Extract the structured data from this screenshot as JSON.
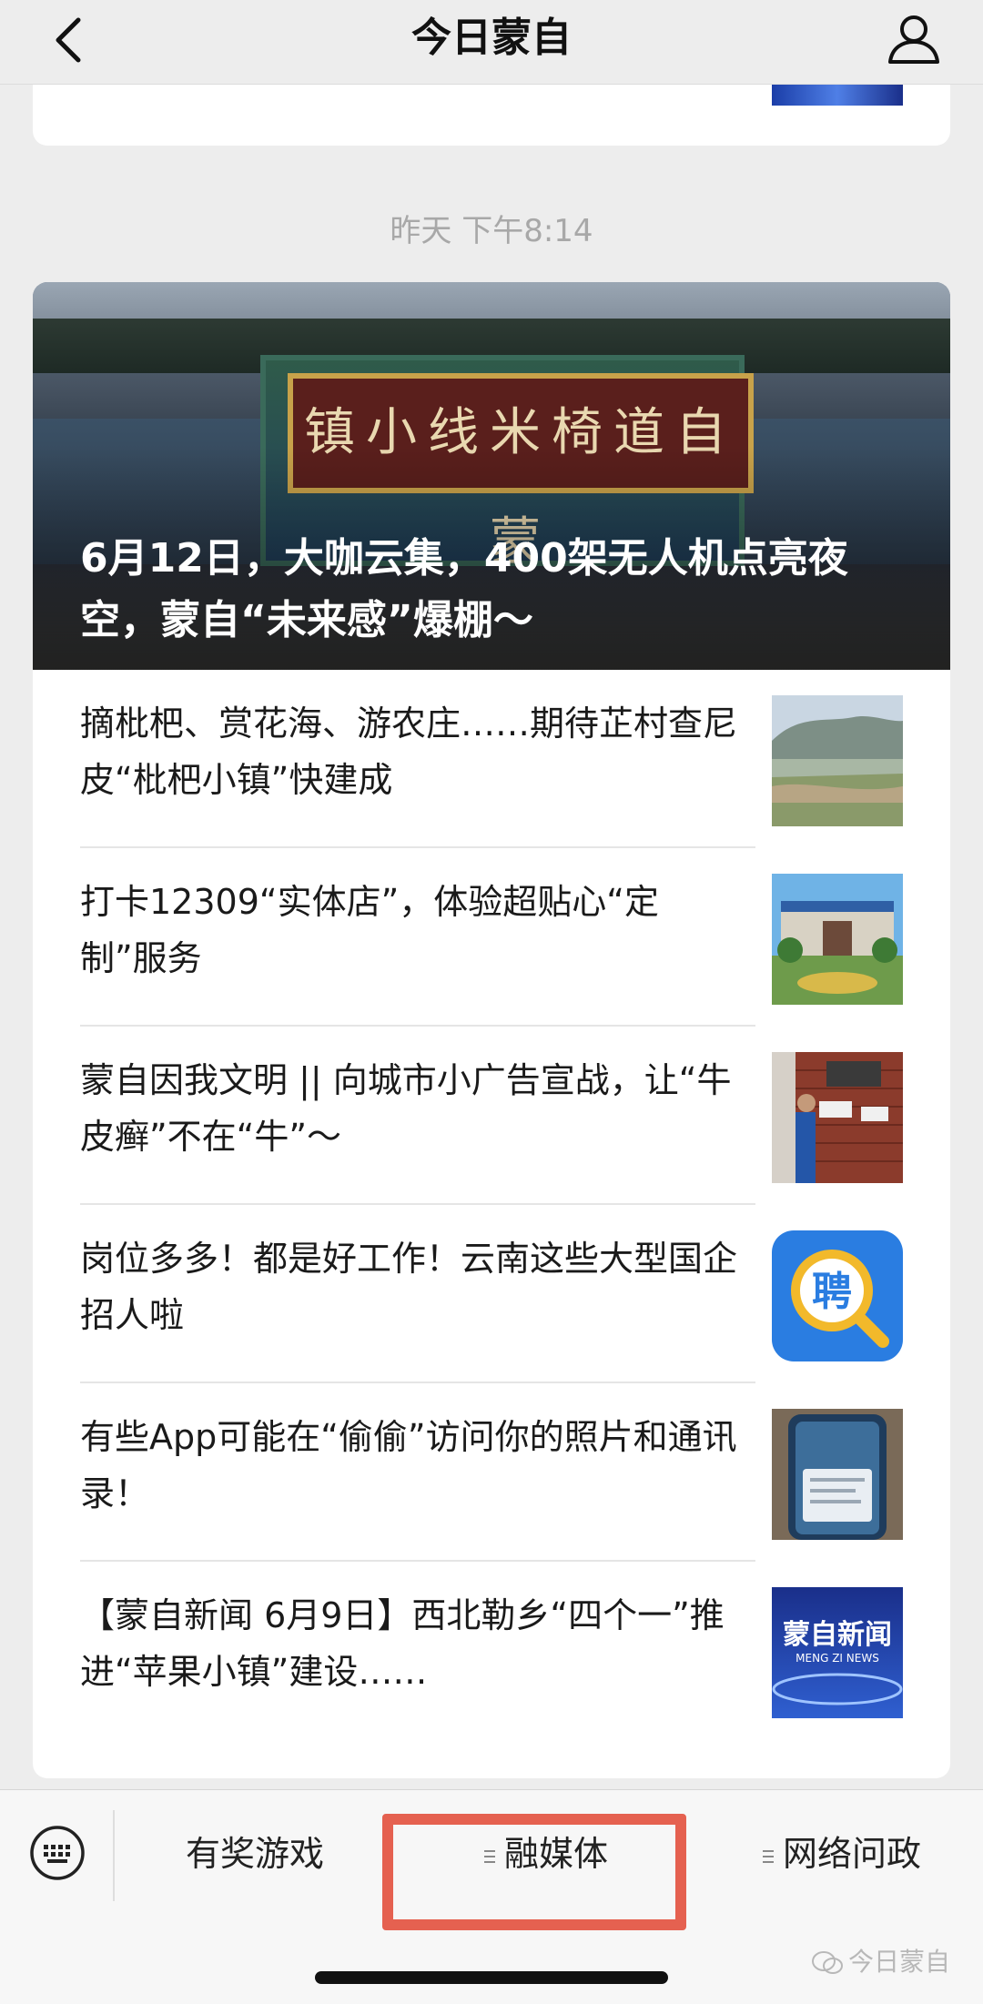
{
  "nav": {
    "title": "今日蒙自",
    "back_icon": "chevron-left-icon",
    "profile_icon": "person-icon"
  },
  "timestamp": "昨天 下午8:14",
  "hero": {
    "plaque_text": "镇小线米椅道自蒙",
    "title": "6月12日，大咖云集，400架无人机点亮夜空，蒙自“未来感”爆棚～"
  },
  "articles": [
    {
      "title": "摘枇杷、赏花海、游农庄……期待芷村查尼皮“枇杷小镇”快建成"
    },
    {
      "title": "打卡12309“实体店”，体验超贴心“定制”服务"
    },
    {
      "title": "蒙自因我文明 || 向城市小广告宣战，让“牛皮癣”不在“牛”～"
    },
    {
      "title": "岗位多多！都是好工作！云南这些大型国企招人啦",
      "thumb_text": "聘"
    },
    {
      "title": "有些App可能在“偷偷”访问你的照片和通讯录！"
    },
    {
      "title": "【蒙自新闻 6月9日】西北勒乡“四个一”推进“苹果小镇”建设……",
      "thumb_text": "蒙自新闻",
      "thumb_sub": "MENG ZI NEWS"
    }
  ],
  "bottom_menu": {
    "keyboard_icon": "keyboard-icon",
    "items": [
      "有奖游戏",
      "融媒体",
      "网络问政"
    ]
  },
  "watermark": "今日蒙自",
  "colors": {
    "highlight": "#e24632",
    "background": "#ededed"
  }
}
